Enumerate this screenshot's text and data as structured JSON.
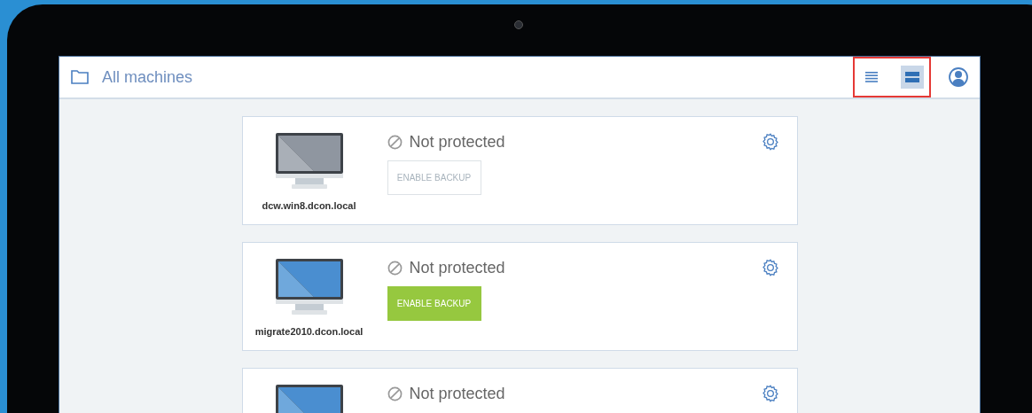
{
  "header": {
    "title": "All machines",
    "view_modes": [
      {
        "kind": "list",
        "selected": false
      },
      {
        "kind": "cards",
        "selected": true
      }
    ]
  },
  "machines": [
    {
      "name": "dcw.win8.dcon.local",
      "online": false,
      "status": "Not protected",
      "button": {
        "label": "ENABLE BACKUP",
        "enabled": false
      }
    },
    {
      "name": "migrate2010.dcon.local",
      "online": true,
      "status": "Not protected",
      "button": {
        "label": "ENABLE BACKUP",
        "enabled": true
      }
    },
    {
      "online": true,
      "status": "Not protected"
    }
  ]
}
